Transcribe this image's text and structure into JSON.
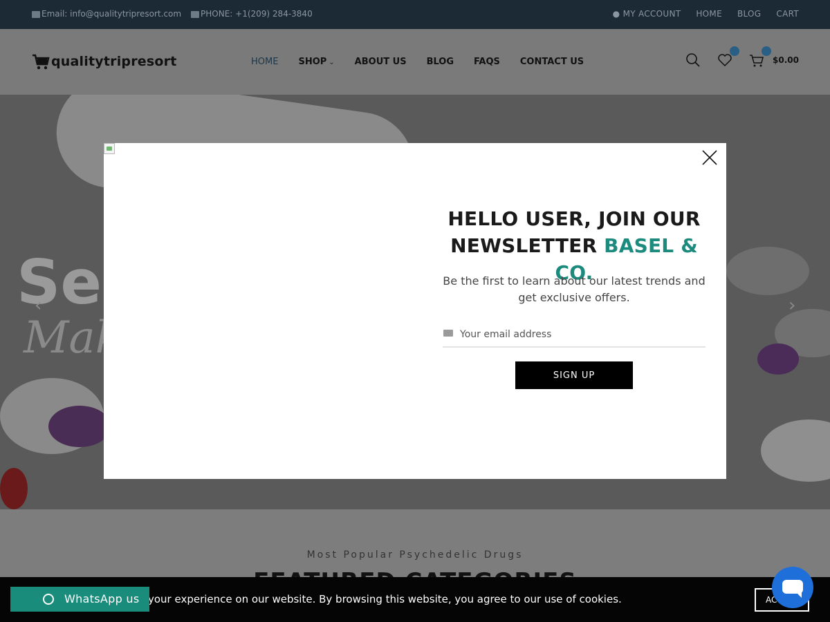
{
  "topbar": {
    "email": "Email: info@qualitytripresort.com",
    "phone": "PHONE: +1(209) 284-3840",
    "links": [
      "MY ACCOUNT",
      "HOME",
      "BLOG",
      "CART"
    ]
  },
  "header": {
    "logo_text": "qualitytripresort",
    "nav": [
      "HOME",
      "SHOP",
      "ABOUT US",
      "BLOG",
      "FAQS",
      "CONTACT US"
    ],
    "wishlist_count": "0",
    "cart_count": "0",
    "cart_total": "$0.00"
  },
  "hero": {
    "word1": "Se",
    "word2": "Mak"
  },
  "section": {
    "kicker": "Most Popular Psychedelic Drugs",
    "heading": "FEATURED CATEGORIES"
  },
  "modal": {
    "title_line1": "HELLO USER, JOIN OUR",
    "title_line2": "NEWSLETTER",
    "title_accent": "BASEL & CO.",
    "subtitle": "Be the first to learn about our latest trends and get exclusive offers.",
    "email_placeholder": "Your email address",
    "signup_label": "SIGN UP"
  },
  "cookie": {
    "message": "your experience on our website. By browsing this website, you agree to our use of cookies.",
    "accept_label": "ACCEPT"
  },
  "whatsapp": {
    "label": "WhatsApp us"
  },
  "colors": {
    "accent": "#1d8a7e",
    "topbar_bg": "#1b2a35",
    "whatsapp_bg": "#1a8c7c",
    "chat_bg": "#1e6fd9"
  }
}
